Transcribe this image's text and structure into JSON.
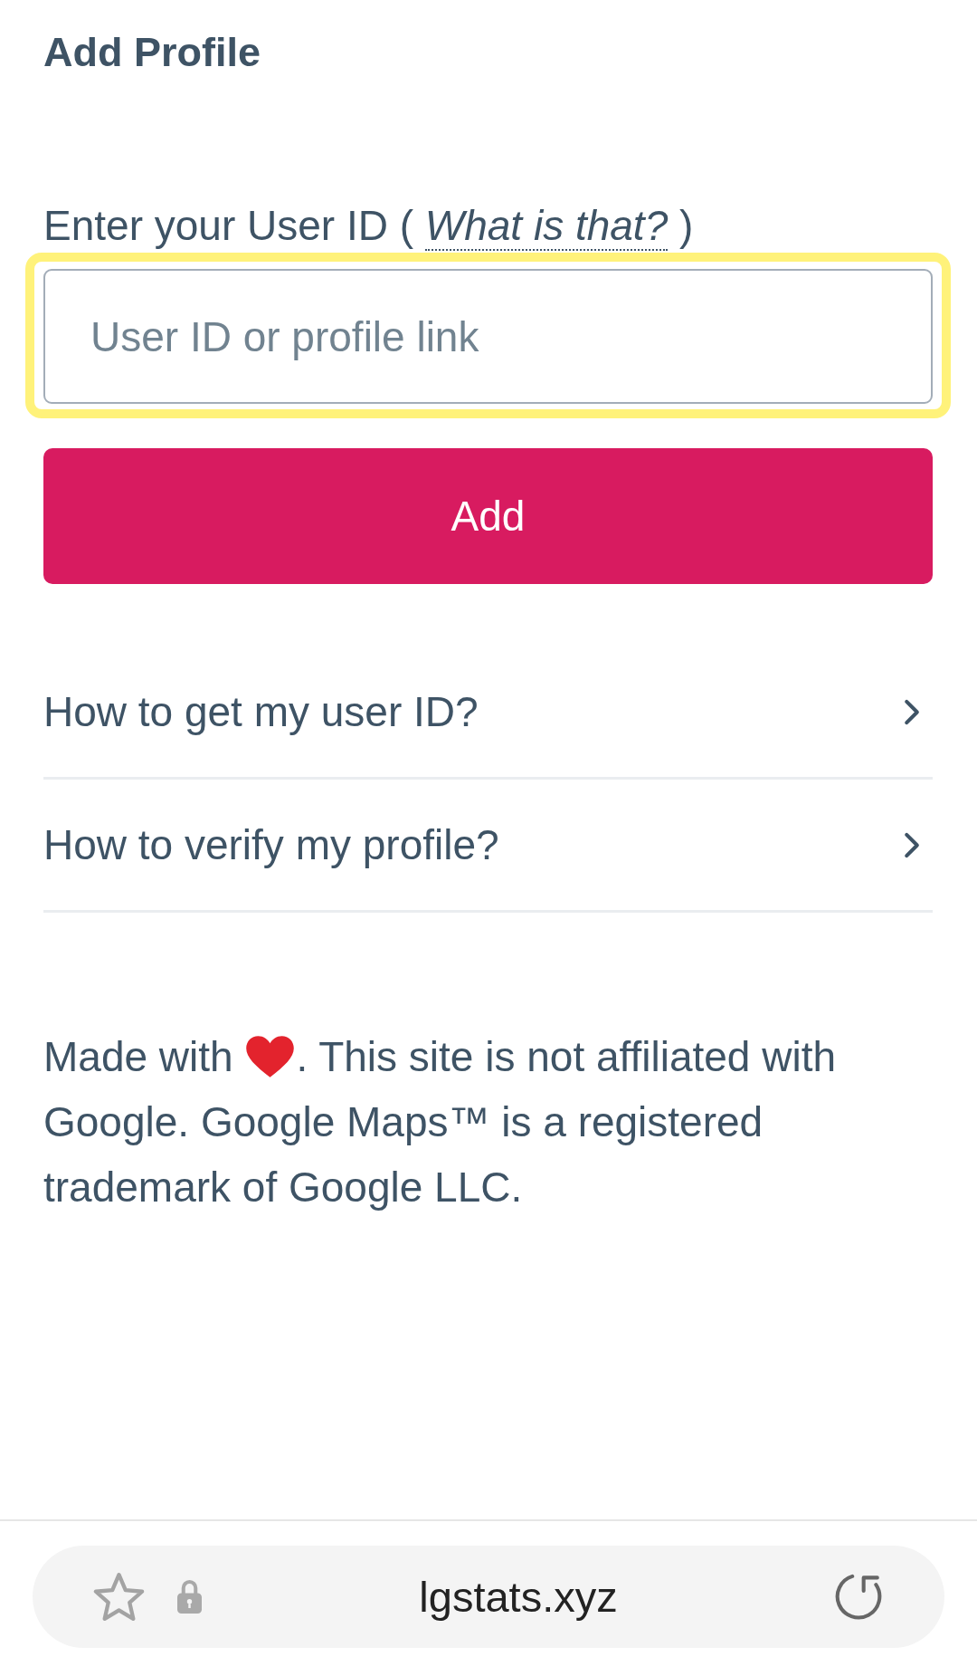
{
  "page": {
    "title": "Add Profile"
  },
  "form": {
    "label": {
      "before": "Enter your User ID (",
      "link": "What is that?",
      "after": ")"
    },
    "input": {
      "placeholder": "User ID or profile link",
      "focused": true
    },
    "submit": {
      "label": "Add"
    }
  },
  "help": [
    {
      "question": "How to get my user ID?",
      "expanded": false
    },
    {
      "question": "How to verify my profile?",
      "expanded": false
    }
  ],
  "footer": {
    "before_icon": "Made with",
    "after_icon": ". This site is not affiliated with Google. Google Maps™ is a registered trademark of Google LLC."
  },
  "browser": {
    "url": "lgstats.xyz"
  }
}
